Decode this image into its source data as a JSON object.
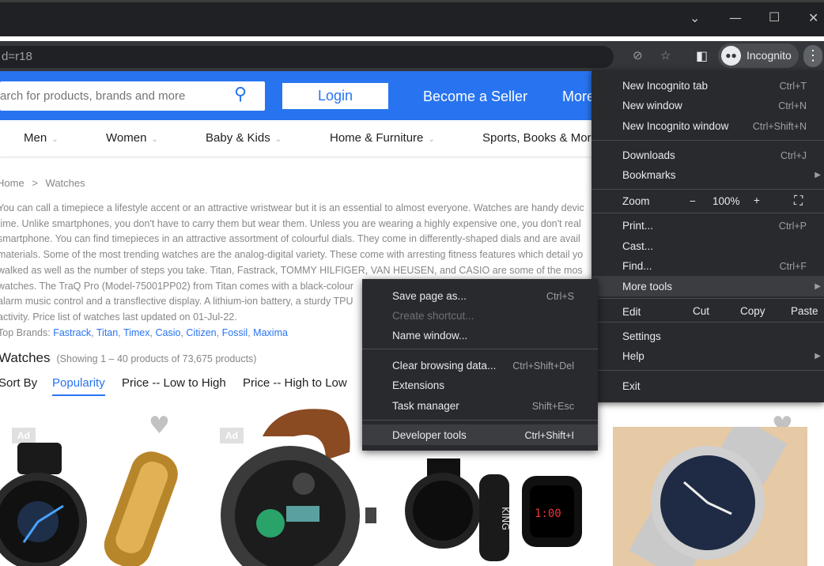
{
  "browser": {
    "url": "d=r18",
    "profile_label": "Incognito",
    "accent": "#2874f0"
  },
  "header": {
    "search_placeholder": "arch for products, brands and more",
    "login_label": "Login",
    "seller_label": "Become a Seller",
    "more_label": "More"
  },
  "categories": [
    "Men",
    "Women",
    "Baby & Kids",
    "Home & Furniture",
    "Sports, Books & Mor"
  ],
  "breadcrumb": {
    "home": "Home",
    "sep": ">",
    "current": "Watches"
  },
  "description": [
    "You can call a timepiece a lifestyle accent or an attractive wristwear but it is an essential to almost everyone. Watches are handy devic",
    "time. Unlike smartphones, you don't have to carry them but wear them. Unless you are wearing a highly expensive one, you don't real",
    "smartphone. You can find timepieces in an attractive assortment of colourful dials. They come in differently-shaped dials and are avail",
    "materials. Some of the most trending watches are the analog-digital variety. These come with arresting fitness features which detail yo",
    "walked as well as the number of steps you take. Titan, Fastrack, TOMMY HILFIGER, VAN HEUSEN, and CASIO are some of the mos",
    "watches. The TraQ Pro (Model-75001PP02) from Titan comes with a black-colour",
    "alarm music control and a transflective display. A lithium-ion battery, a sturdy TPU",
    "activity. Price list of watches last updated on 01-Jul-22."
  ],
  "top_brands": {
    "label": "Top Brands:",
    "brands": [
      "Fastrack",
      "Titan",
      "Timex",
      "Casio",
      "Citizen",
      "Fossil",
      "Maxima"
    ]
  },
  "listing": {
    "title": "Watches",
    "count": "(Showing 1 – 40 products of 73,675 products)",
    "sort_label": "Sort By",
    "sort_options": [
      "Popularity",
      "Price -- Low to High",
      "Price -- High to Low"
    ],
    "ad_badge": "Ad"
  },
  "chrome_menu": {
    "items": [
      {
        "label": "New Incognito tab",
        "shortcut": "Ctrl+T"
      },
      {
        "label": "New window",
        "shortcut": "Ctrl+N"
      },
      {
        "label": "New Incognito window",
        "shortcut": "Ctrl+Shift+N"
      },
      {
        "label": "Downloads",
        "shortcut": "Ctrl+J"
      },
      {
        "label": "Bookmarks",
        "shortcut": ""
      },
      {
        "label": "Zoom",
        "shortcut": ""
      },
      {
        "label": "Print...",
        "shortcut": "Ctrl+P"
      },
      {
        "label": "Cast...",
        "shortcut": ""
      },
      {
        "label": "Find...",
        "shortcut": "Ctrl+F"
      },
      {
        "label": "More tools",
        "shortcut": ""
      },
      {
        "label": "Edit",
        "shortcut": ""
      },
      {
        "label": "Settings",
        "shortcut": ""
      },
      {
        "label": "Help",
        "shortcut": ""
      },
      {
        "label": "Exit",
        "shortcut": ""
      }
    ],
    "zoom": {
      "minus": "−",
      "value": "100%",
      "plus": "+"
    },
    "edit": {
      "cut": "Cut",
      "copy": "Copy",
      "paste": "Paste"
    }
  },
  "more_tools_menu": {
    "items": [
      {
        "label": "Save page as...",
        "shortcut": "Ctrl+S"
      },
      {
        "label": "Create shortcut...",
        "shortcut": ""
      },
      {
        "label": "Name window...",
        "shortcut": ""
      },
      {
        "label": "Clear browsing data...",
        "shortcut": "Ctrl+Shift+Del"
      },
      {
        "label": "Extensions",
        "shortcut": ""
      },
      {
        "label": "Task manager",
        "shortcut": "Shift+Esc"
      },
      {
        "label": "Developer tools",
        "shortcut": "Ctrl+Shift+I"
      }
    ]
  }
}
